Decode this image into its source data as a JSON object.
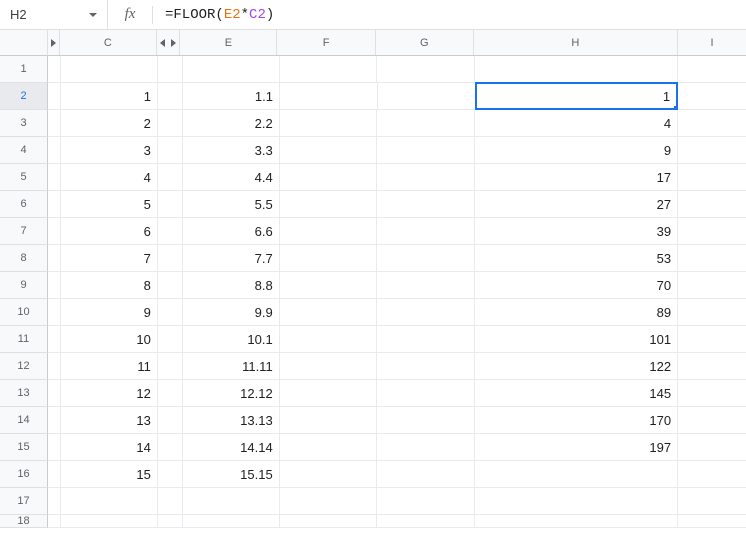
{
  "nameBox": "H2",
  "formula": {
    "func": "=FLOOR",
    "open": "(",
    "ref1": "E2",
    "op": "*",
    "ref2": "C2",
    "close": ")"
  },
  "fx": "fx",
  "columns": {
    "C": "C",
    "E": "E",
    "F": "F",
    "G": "G",
    "H": "H",
    "I": "I"
  },
  "rowLabels": [
    "1",
    "2",
    "3",
    "4",
    "5",
    "6",
    "7",
    "8",
    "9",
    "10",
    "11",
    "12",
    "13",
    "14",
    "15",
    "16",
    "17",
    "18"
  ],
  "rows": [
    {
      "C": "",
      "E": "",
      "H": ""
    },
    {
      "C": "1",
      "E": "1.1",
      "H": "1"
    },
    {
      "C": "2",
      "E": "2.2",
      "H": "4"
    },
    {
      "C": "3",
      "E": "3.3",
      "H": "9"
    },
    {
      "C": "4",
      "E": "4.4",
      "H": "17"
    },
    {
      "C": "5",
      "E": "5.5",
      "H": "27"
    },
    {
      "C": "6",
      "E": "6.6",
      "H": "39"
    },
    {
      "C": "7",
      "E": "7.7",
      "H": "53"
    },
    {
      "C": "8",
      "E": "8.8",
      "H": "70"
    },
    {
      "C": "9",
      "E": "9.9",
      "H": "89"
    },
    {
      "C": "10",
      "E": "10.1",
      "H": "101"
    },
    {
      "C": "11",
      "E": "11.11",
      "H": "122"
    },
    {
      "C": "12",
      "E": "12.12",
      "H": "145"
    },
    {
      "C": "13",
      "E": "13.13",
      "H": "170"
    },
    {
      "C": "14",
      "E": "14.14",
      "H": "197"
    },
    {
      "C": "15",
      "E": "15.15",
      "H": ""
    },
    {
      "C": "",
      "E": "",
      "H": ""
    },
    {
      "C": "",
      "E": "",
      "H": ""
    }
  ],
  "selectedCell": "H2"
}
